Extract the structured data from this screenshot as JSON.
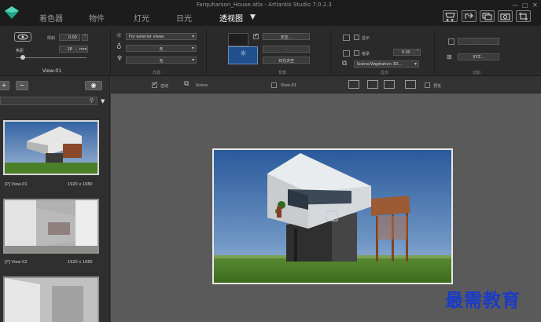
{
  "window": {
    "title": "Farquharson_House.atla - Artlantis Studio 7.0.2.3"
  },
  "tabs": [
    {
      "label": "着色器",
      "active": false
    },
    {
      "label": "物件",
      "active": false
    },
    {
      "label": "灯光",
      "active": false
    },
    {
      "label": "日光",
      "active": false
    },
    {
      "label": "透视图",
      "active": true
    }
  ],
  "toolbar_icons": [
    "cart-icon",
    "export-icon",
    "windows-icon",
    "camera-icon",
    "crop-icon",
    "close-window-icon"
  ],
  "window_controls": {
    "minimize": "—",
    "maximize": "□",
    "close": "✕"
  },
  "properties": {
    "view_name": "View-01",
    "tilt_label": "倾斜",
    "tilt_value": "0.00",
    "focal_label": "焦距",
    "focal_value": "28",
    "focal_unit": "mm",
    "environment_value": "For exterior views",
    "light_value": "无",
    "filter_value": "无",
    "section_light": "光源",
    "section_bg": "背景",
    "sky_button": "天空...",
    "sky_value": "日光天空",
    "section_display": "显示",
    "show_label": "显示",
    "inherit_label": "继承",
    "inherit_value": "0.00",
    "scene_value": "Scène/Végétation 3D...",
    "xyz_button": "XYZ...",
    "section_clip": "切割"
  },
  "left_panel": {
    "views": [
      {
        "name": "View-01",
        "size": "1920 x 1080",
        "prefix": "[P]"
      },
      {
        "name": "View-02",
        "size": "1920 x 1080",
        "prefix": "[P]"
      }
    ]
  },
  "viewport_toolbar": {
    "auto_label": "自动",
    "scene_label": "Scène",
    "view_select": "View-01",
    "preview_label": "预览"
  },
  "watermark": "最需教育",
  "colors": {
    "accent_tab": "#ffffff",
    "watermark": "#1a3cc8",
    "sky": "#3f6fb0",
    "grass": "#4f8a2c"
  }
}
